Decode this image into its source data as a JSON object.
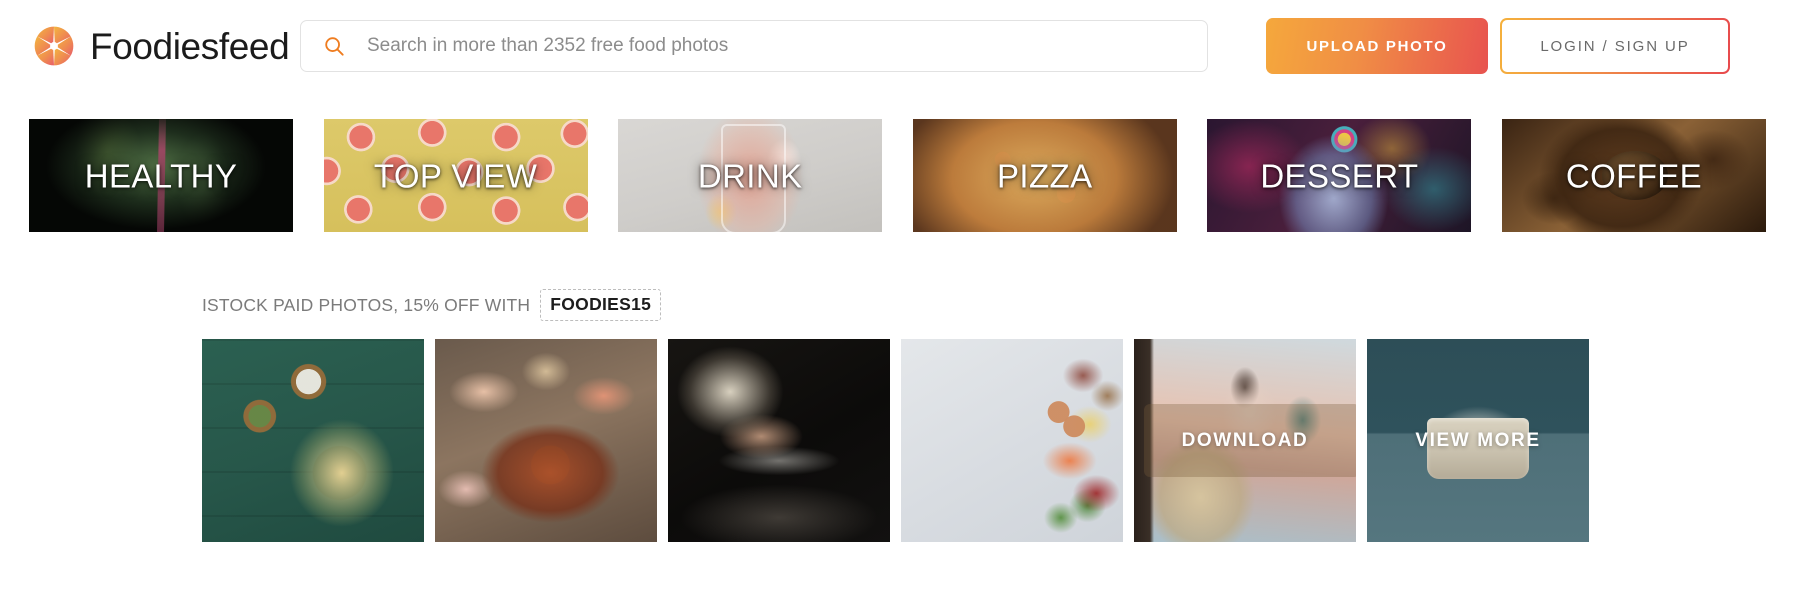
{
  "header": {
    "brand_name": "Foodiesfeed",
    "logo_icon": "aperture-icon",
    "search": {
      "icon": "search-icon",
      "placeholder": "Search in more than 2352 free food photos",
      "value": ""
    },
    "upload_label": "UPLOAD PHOTO",
    "login_label": "LOGIN / SIGN UP",
    "accent_start": "#f5a83c",
    "accent_end": "#e8534f"
  },
  "categories": [
    {
      "label": "HEALTHY",
      "art": "art-healthy"
    },
    {
      "label": "TOP VIEW",
      "art": "art-topview"
    },
    {
      "label": "DRINK",
      "art": "art-drink"
    },
    {
      "label": "PIZZA",
      "art": "art-pizza"
    },
    {
      "label": "DESSERT",
      "art": "art-dessert"
    },
    {
      "label": "COFFEE",
      "art": "art-coffee"
    }
  ],
  "promo": {
    "text": "ISTOCK PAID PHOTOS, 15% OFF WITH",
    "code": "FOODIES15",
    "thumbnails": [
      {
        "art": "th-pasta",
        "overlay": ""
      },
      {
        "art": "th-hotpot",
        "overlay": ""
      },
      {
        "art": "th-chef",
        "overlay": ""
      },
      {
        "art": "th-protein",
        "overlay": ""
      },
      {
        "art": "th-family",
        "overlay": "DOWNLOAD"
      },
      {
        "art": "th-steamer",
        "overlay": "VIEW MORE"
      }
    ]
  }
}
